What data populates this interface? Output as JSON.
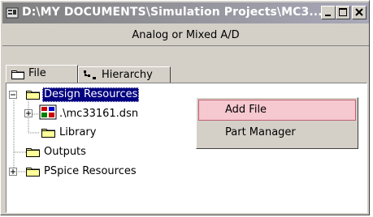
{
  "window": {
    "title": "D:\\MY DOCUMENTS\\Simulation Projects\\MC3...",
    "subheader": "Analog or Mixed A/D"
  },
  "tabs": [
    {
      "label": "File"
    },
    {
      "label": "Hierarchy"
    }
  ],
  "tree": {
    "design_resources": "Design Resources",
    "dsn_file": ".\\mc33161.dsn",
    "library": "Library",
    "outputs": "Outputs",
    "pspice_resources": "PSpice Resources"
  },
  "context_menu": {
    "items": [
      {
        "label": "Add File"
      },
      {
        "label": "Part Manager"
      }
    ]
  }
}
